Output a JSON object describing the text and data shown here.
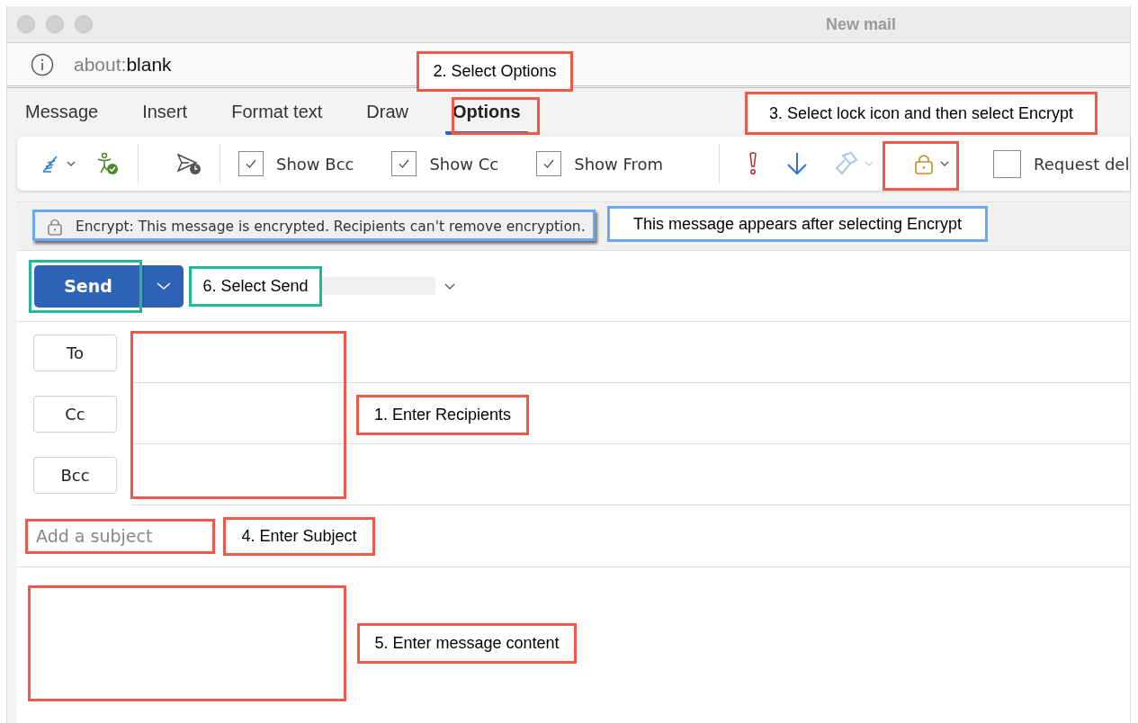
{
  "window": {
    "title": "New mail",
    "address_scheme": "about:",
    "address_rest": "blank"
  },
  "tabs": [
    {
      "label": "Message",
      "selected": false
    },
    {
      "label": "Insert",
      "selected": false
    },
    {
      "label": "Format text",
      "selected": false
    },
    {
      "label": "Draw",
      "selected": false
    },
    {
      "label": "Options",
      "selected": true
    }
  ],
  "toolbar_checkboxes": [
    {
      "label": "Show Bcc",
      "checked": true
    },
    {
      "label": "Show Cc",
      "checked": true
    },
    {
      "label": "Show From",
      "checked": true
    }
  ],
  "request_checkbox": {
    "label": "Request del",
    "checked": false
  },
  "encrypt_bar": {
    "text": "Encrypt: This message is encrypted. Recipients can't remove encryption."
  },
  "send_button": {
    "label": "Send"
  },
  "recipients": [
    {
      "label": "To"
    },
    {
      "label": "Cc"
    },
    {
      "label": "Bcc"
    }
  ],
  "subject": {
    "placeholder": "Add a subject"
  },
  "callouts": [
    {
      "text": "2. Select Options",
      "color": "#f0584a"
    },
    {
      "text": "3. Select lock icon and then select Encrypt",
      "color": "#f0584a"
    },
    {
      "text": "This message appears after selecting Encrypt",
      "color": "#6aa8f5"
    },
    {
      "text": "6. Select Send",
      "color": "#1fb89a"
    },
    {
      "text": "1. Enter Recipients",
      "color": "#f0584a"
    },
    {
      "text": "4. Enter Subject",
      "color": "#f0584a"
    },
    {
      "text": "5. Enter message content",
      "color": "#f0584a"
    }
  ],
  "highlights": [
    {
      "color": "#f0584a"
    },
    {
      "color": "#f0584a"
    },
    {
      "color": "#6aa8f5"
    },
    {
      "color": "#1fb89a"
    },
    {
      "color": "#f0584a"
    },
    {
      "color": "#f0584a"
    },
    {
      "color": "#f0584a"
    }
  ]
}
